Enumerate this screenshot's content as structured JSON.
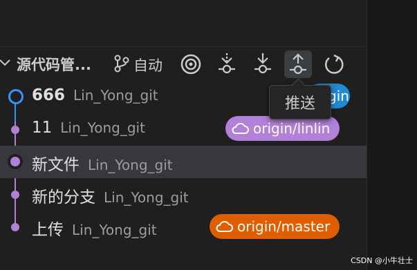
{
  "header": {
    "title": "源代码管...",
    "branch_label": "自动"
  },
  "tooltip": {
    "text": "推送"
  },
  "commits": [
    {
      "message": "666",
      "author": "Lin_Yong_git",
      "badge": "origin",
      "badge_color": "#1f8ad2",
      "head": true
    },
    {
      "message": "11",
      "author": "Lin_Yong_git",
      "badge": "origin/linlin",
      "badge_color": "#b180d7"
    },
    {
      "message": "新文件",
      "author": "Lin_Yong_git",
      "selected": true
    },
    {
      "message": "新的分支",
      "author": "Lin_Yong_git"
    },
    {
      "message": "上传",
      "author": "Lin_Yong_git",
      "badge": "origin/master",
      "badge_color": "#e05d00"
    }
  ],
  "icons": {
    "toolbar": [
      "target-icon",
      "fetch-icon",
      "pull-icon",
      "push-icon",
      "refresh-icon"
    ]
  },
  "watermark": "CSDN @小牛壮士",
  "colors": {
    "graph": "#b180d7",
    "head": "#3794ff"
  }
}
